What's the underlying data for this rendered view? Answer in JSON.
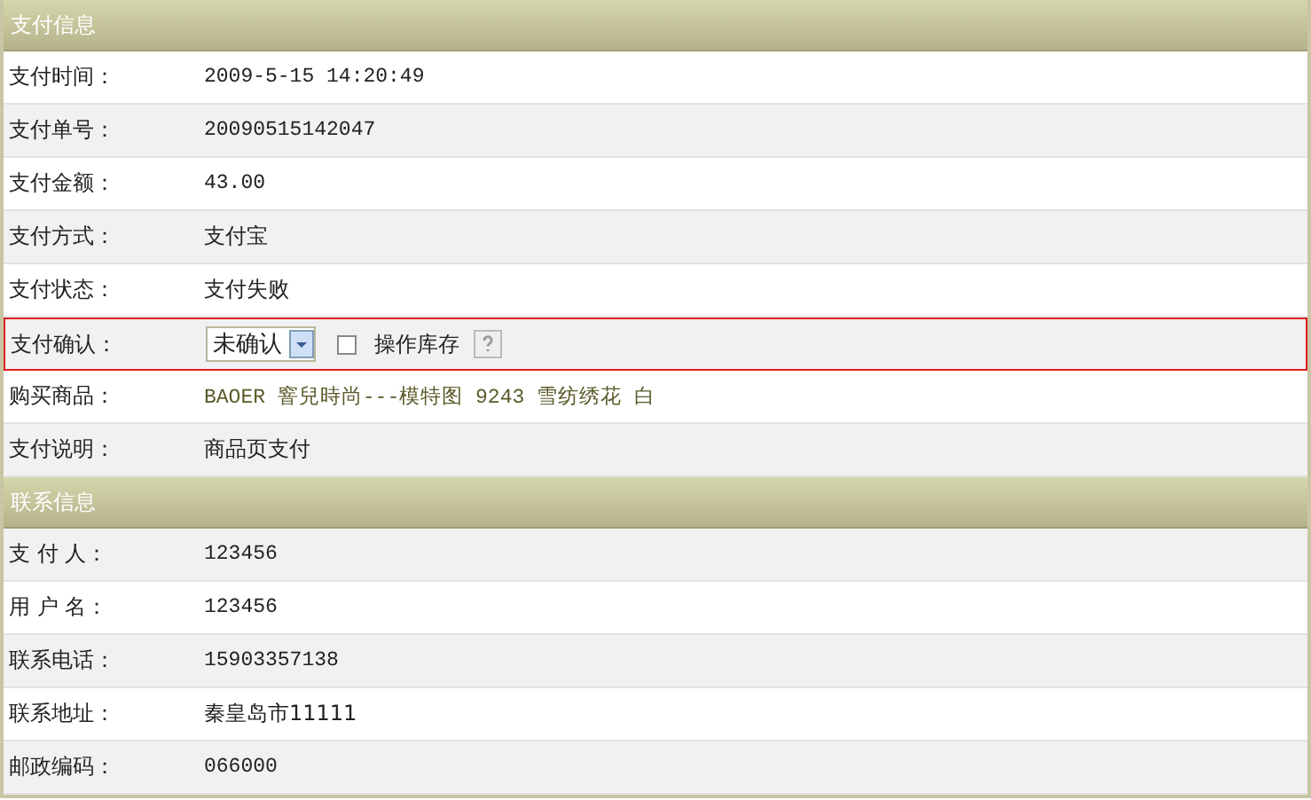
{
  "sections": [
    {
      "title": "支付信息",
      "rows": [
        {
          "kind": "text",
          "label": "支付时间：",
          "value": "2009-5-15 14:20:49",
          "highlighted": false
        },
        {
          "kind": "text",
          "label": "支付单号：",
          "value": "20090515142047",
          "highlighted": false
        },
        {
          "kind": "text",
          "label": "支付金额：",
          "value": "43.00",
          "highlighted": false
        },
        {
          "kind": "text",
          "label": "支付方式：",
          "value": "支付宝",
          "highlighted": false
        },
        {
          "kind": "text",
          "label": "支付状态：",
          "value": "支付失败",
          "highlighted": false
        },
        {
          "kind": "select",
          "label": "支付确认：",
          "value": "未确认",
          "checkbox": {
            "label": "操作库存",
            "checked": false
          },
          "highlighted": true
        },
        {
          "kind": "link",
          "label": "购买商品：",
          "value": "BAOER 窨兒時尚---模特图 9243 雪纺绣花 白",
          "highlighted": false
        },
        {
          "kind": "text",
          "label": "支付说明：",
          "value": "商品页支付",
          "highlighted": false
        }
      ]
    },
    {
      "title": "联系信息",
      "rows": [
        {
          "kind": "text",
          "label": "支 付 人：",
          "value": "123456",
          "highlighted": false
        },
        {
          "kind": "text",
          "label": "用 户 名：",
          "value": "123456",
          "highlighted": false
        },
        {
          "kind": "text",
          "label": "联系电话：",
          "value": "15903357138",
          "highlighted": false
        },
        {
          "kind": "text",
          "label": "联系地址：",
          "value": "秦皇岛市11111",
          "highlighted": false
        },
        {
          "kind": "text",
          "label": "邮政编码：",
          "value": "066000",
          "highlighted": false
        }
      ]
    }
  ]
}
